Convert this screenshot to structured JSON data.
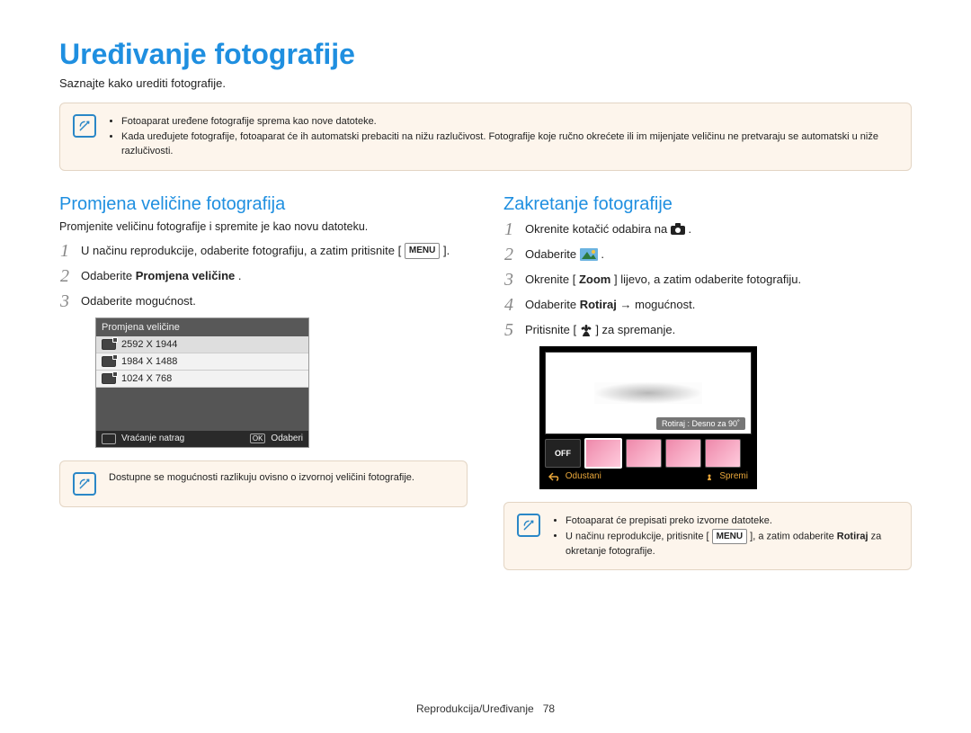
{
  "page": {
    "title": "Uređivanje fotografije",
    "subtitle": "Saznajte kako urediti fotografije.",
    "footer_section": "Reprodukcija/Uređivanje",
    "footer_page": "78"
  },
  "top_note": {
    "items": [
      "Fotoaparat uređene fotografije sprema kao nove datoteke.",
      "Kada uređujete fotografije, fotoaparat će ih automatski prebaciti na nižu razlučivost. Fotografije koje ručno okrećete ili im mijenjate veličinu ne pretvaraju se automatski u niže razlučivosti."
    ]
  },
  "left": {
    "heading": "Promjena veličine fotografija",
    "subtitle": "Promjenite veličinu fotografije i spremite je kao novu datoteku.",
    "steps": {
      "s1a": "U načinu reprodukcije, odaberite fotografiju, a zatim pritisnite [",
      "s1b": "].",
      "menu_label": "MENU",
      "s2a": "Odaberite ",
      "s2b": "Promjena veličine",
      "s2c": ".",
      "s3": "Odaberite mogućnost."
    },
    "cam": {
      "title": "Promjena veličine",
      "rows": [
        "2592 X 1944",
        "1984 X 1488",
        "1024 X 768"
      ],
      "foot_back": "Vraćanje natrag",
      "foot_ok": "Odaberi",
      "ok_btn": "OK"
    },
    "bottom_note": "Dostupne se mogućnosti razlikuju ovisno o izvornoj veličini fotografije."
  },
  "right": {
    "heading": "Zakretanje fotografije",
    "steps": {
      "s1a": "Okrenite kotačić odabira na ",
      "s1b": ".",
      "s2a": "Odaberite ",
      "s2b": ".",
      "s3a": "Okrenite [",
      "s3b": "Zoom",
      "s3c": "] lijevo, a zatim odaberite fotografiju.",
      "s4a": "Odaberite ",
      "s4b": "Rotiraj",
      "s4c": " → mogućnost.",
      "s5a": "Pritisnite [",
      "s5b": "] za spremanje."
    },
    "rotate_ui": {
      "label": "Rotiraj : Desno za 90˚",
      "off": "OFF",
      "foot_cancel": "Odustani",
      "foot_save": "Spremi"
    },
    "bottom_note": {
      "items_a": [
        "Fotoaparat će prepisati preko izvorne datoteke."
      ],
      "b_pre": "U načinu reprodukcije, pritisnite [",
      "b_menu": "MENU",
      "b_mid": "], a zatim odaberite ",
      "b_bold": "Rotiraj",
      "b_post": " za okretanje fotografije."
    }
  }
}
